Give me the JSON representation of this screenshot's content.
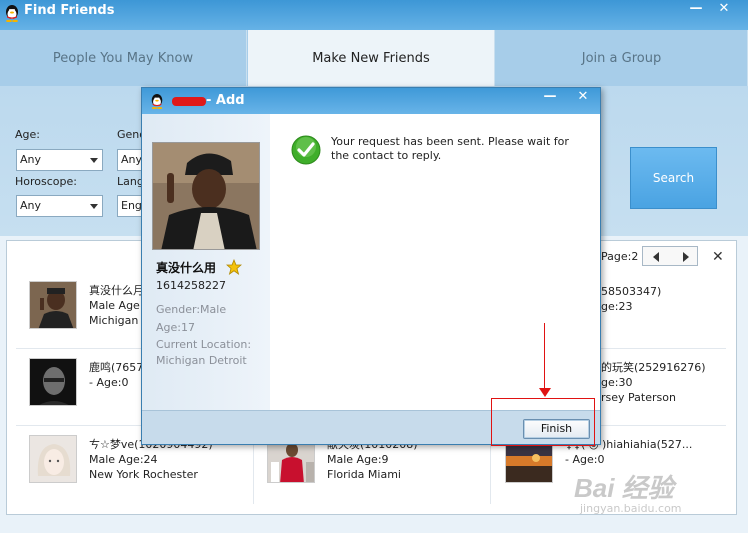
{
  "window": {
    "title": "Find Friends",
    "min_glyph": "—",
    "close_glyph": "✕"
  },
  "tabs": [
    {
      "label": "People You May Know"
    },
    {
      "label": "Make New Friends"
    },
    {
      "label": "Join a Group"
    }
  ],
  "filters": {
    "age_label": "Age:",
    "age_value": "Any",
    "gender_label": "Gend",
    "gender_value": "Any",
    "horoscope_label": "Horoscope:",
    "horoscope_value": "Any",
    "language_label": "Langu",
    "language_value": "Engl"
  },
  "search": {
    "label": "Search"
  },
  "pagination": {
    "label": "Page:2"
  },
  "results": [
    {
      "line1": "真没什么月",
      "line2": "Male  Age:",
      "line3": "Michigan D"
    },
    {
      "line1": "58503347)",
      "line2": "ge:23",
      "line3": ""
    },
    {
      "line1": "鹿鸣(7657",
      "line2": "-  Age:0",
      "line3": ""
    },
    {
      "line1": "的玩笑(252916276)",
      "line2": "ge:30",
      "line3": "rsey Paterson"
    },
    {
      "line1": "ㄘ☆梦ve(1020904492)",
      "line2": "Male  Age:24",
      "line3": "New York Rochester"
    },
    {
      "line1": "献天炭(1010208)",
      "line2": "Male  Age:9",
      "line3": "Florida Miami"
    },
    {
      "line1": "♀♀(     ◎     )hiahiahia(527...",
      "line2": "-  Age:0",
      "line3": ""
    }
  ],
  "dialog": {
    "title": "- Add",
    "min_glyph": "—",
    "close_glyph": "✕",
    "message": "Your request has been sent. Please wait for the contact to reply.",
    "finish_label": "Finish"
  },
  "profile": {
    "name": "真没什么用",
    "qq_number": "1614258227",
    "gender": "Gender:Male",
    "age": "Age:17",
    "location_label": "Current Location:",
    "location": "Michigan  Detroit"
  },
  "watermark": {
    "main": "Bai 经验",
    "sub": "jingyan.baidu.com"
  },
  "colors": {
    "title_bar": "#4aa3e2",
    "tab_bar": "#a7cde9",
    "active_tab": "#edf4f9",
    "search_button": "#5aaee8",
    "annotation": "#e01212",
    "check_green": "#3fae2a"
  }
}
